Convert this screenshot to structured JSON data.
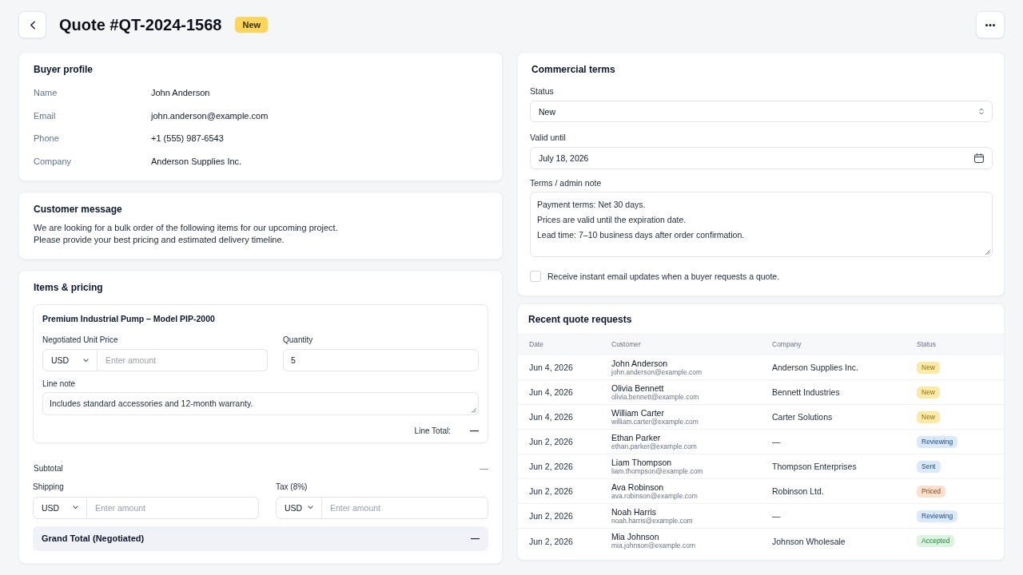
{
  "header": {
    "title": "Quote #QT-2024-1568",
    "badge": "New"
  },
  "buyer_profile": {
    "title": "Buyer profile",
    "fields": [
      {
        "label": "Name",
        "value": "John Anderson"
      },
      {
        "label": "Email",
        "value": "john.anderson@example.com"
      },
      {
        "label": "Phone",
        "value": "+1 (555) 987-6543"
      },
      {
        "label": "Company",
        "value": "Anderson Supplies Inc."
      }
    ]
  },
  "customer_message": {
    "title": "Customer message",
    "text": "We are looking for a bulk order of the following items for our upcoming project.\nPlease provide your best pricing and estimated delivery timeline."
  },
  "items_pricing": {
    "title": "Items & pricing",
    "items": [
      {
        "name": "Premium Industrial Pump – Model PIP-2000",
        "unit_price": {
          "label": "Negotiated Unit Price",
          "currency": "USD",
          "placeholder": "Enter amount"
        },
        "quantity": {
          "label": "Quantity",
          "value": "5"
        },
        "line_note": {
          "label": "Line note",
          "value": "Includes standard accessories and 12-month warranty."
        },
        "line_total": {
          "label": "Line Total:",
          "value": "—"
        }
      }
    ],
    "subtotal": {
      "label": "Subtotal",
      "value": "—"
    },
    "shipping": {
      "label": "Shipping",
      "currency": "USD",
      "placeholder": "Enter amount"
    },
    "tax": {
      "label": "Tax (8%)",
      "currency": "USD",
      "placeholder": "Enter amount"
    },
    "grand_total": {
      "label": "Grand Total (Negotiated)",
      "value": "—"
    }
  },
  "commercial_terms": {
    "title": "Commercial terms",
    "status": {
      "label": "Status",
      "value": "New"
    },
    "valid_until": {
      "label": "Valid until",
      "value": "July 18, 2026"
    },
    "terms_note": {
      "label": "Terms / admin note",
      "value": "Payment terms: Net 30 days.\nPrices are valid until the expiration date.\nLead time: 7–10 business days after order confirmation."
    },
    "email_updates": {
      "label": "Receive instant email updates when a buyer requests a quote.",
      "checked": false
    }
  },
  "recent_requests": {
    "title": "Recent quote requests",
    "columns": [
      "Date",
      "Customer",
      "Company",
      "Status"
    ],
    "rows": [
      {
        "date": "Jun 4, 2026",
        "customer": "John Anderson",
        "email": "john.anderson@example.com",
        "company": "Anderson Supplies Inc.",
        "status": "New",
        "color": "#fdeaa7"
      },
      {
        "date": "Jun 4, 2026",
        "customer": "Olivia Bennett",
        "email": "olivia.bennett@example.com",
        "company": "Bennett Industries",
        "status": "New",
        "color": "#fdeaa7"
      },
      {
        "date": "Jun 4, 2026",
        "customer": "William Carter",
        "email": "william.carter@example.com",
        "company": "Carter Solutions",
        "status": "New",
        "color": "#fdeaa7"
      },
      {
        "date": "Jun 2, 2026",
        "customer": "Ethan Parker",
        "email": "ethan.parker@example.com",
        "company": "—",
        "status": "Reviewing",
        "color": "#dbe9fb"
      },
      {
        "date": "Jun 2, 2026",
        "customer": "Liam Thompson",
        "email": "liam.thompson@example.com",
        "company": "Thompson Enterprises",
        "status": "Sent",
        "color": "#dbe9fb"
      },
      {
        "date": "Jun 2, 2026",
        "customer": "Ava Robinson",
        "email": "ava.robinson@example.com",
        "company": "Robinson Ltd.",
        "status": "Priced",
        "color": "#fde1cf"
      },
      {
        "date": "Jun 2, 2026",
        "customer": "Noah Harris",
        "email": "noah.harris@example.com",
        "company": "—",
        "status": "Reviewing",
        "color": "#dbe9fb"
      },
      {
        "date": "Jun 2, 2026",
        "customer": "Mia Johnson",
        "email": "mia.johnson@example.com",
        "company": "Johnson Wholesale",
        "status": "Accepted",
        "color": "#dcf3e2"
      }
    ]
  }
}
